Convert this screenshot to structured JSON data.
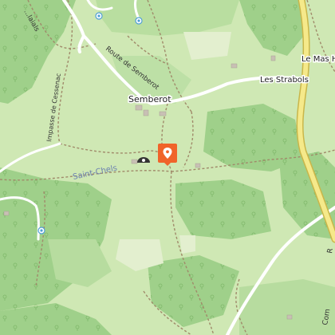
{
  "map": {
    "labels": {
      "route_de_semberot": "Route de Semberot",
      "impasse_de_cessenac": "Impasse de Cessenac",
      "semberot": "Semberot",
      "les_strabols": "Les Strabols",
      "le_mas_h": "Le Mas H",
      "saint_chels": "Saint-Chels",
      "partial_top_left": "...laials",
      "partial_bottom_right": "Com",
      "partial_right_edge": "R"
    },
    "marker": {
      "icon": "map-pin-icon",
      "color": "#f0642a"
    },
    "colors": {
      "meadow": "#cfe8b4",
      "forest": "#9fd08a",
      "road": "#ffffff",
      "main_road": "#f5e98a",
      "main_road_casing": "#c9b64a",
      "track": "#a08a6a",
      "water_icon": "#4f9fd6"
    }
  }
}
